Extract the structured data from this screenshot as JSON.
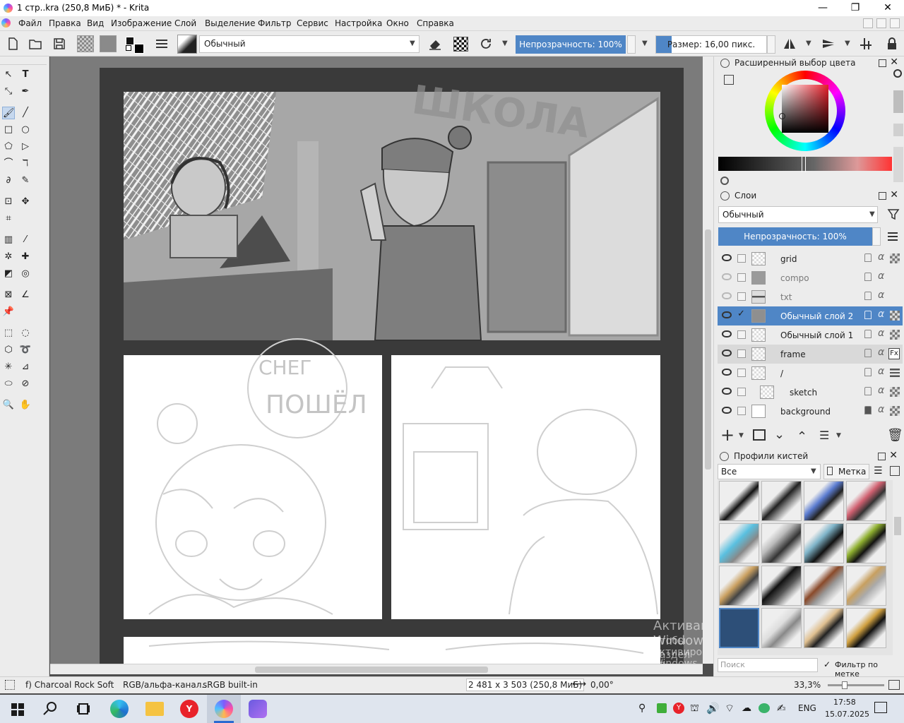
{
  "window": {
    "title": "1 стр..kra (250,8 МиБ) * - Krita",
    "minimize": "—",
    "maximize": "❐",
    "close": "✕"
  },
  "menu": {
    "items": [
      "Файл",
      "Правка",
      "Вид",
      "Изображение",
      "Слой",
      "Выделение",
      "Фильтр",
      "Сервис",
      "Настройка",
      "Окно",
      "Справка"
    ]
  },
  "toolbar": {
    "blend_mode": "Обычный",
    "opacity": "Непрозрачность: 100%",
    "size": "Размер: 16,00 пикс."
  },
  "advanced_color": {
    "title": "Расширенный выбор цвета",
    "hue_color": "#e8202a"
  },
  "layers": {
    "title": "Слои",
    "blend_mode": "Обычный",
    "opacity": "Непрозрачность:  100%",
    "rows": [
      {
        "name": "grid",
        "visible": true,
        "checked": false
      },
      {
        "name": "compo",
        "visible": false,
        "checked": false
      },
      {
        "name": "txt",
        "visible": false,
        "checked": false
      },
      {
        "name": "Обычный слой 2",
        "visible": true,
        "checked": true
      },
      {
        "name": "Обычный слой 1",
        "visible": true,
        "checked": false
      },
      {
        "name": "frame",
        "visible": true,
        "checked": false
      },
      {
        "name": "/",
        "visible": true,
        "checked": false
      },
      {
        "name": "sketch",
        "visible": true,
        "checked": false
      },
      {
        "name": "background",
        "visible": true,
        "checked": false
      }
    ],
    "alpha_glyph": "α",
    "fx_glyph": "Fx"
  },
  "brush_presets": {
    "title": "Профили кистей",
    "filter": "Все",
    "tag": "Метка",
    "search_placeholder": "Поиск",
    "filter_by_tag": "Фильтр по метке"
  },
  "canvas": {
    "panel_text_top": "ШКОЛА",
    "panel_text_bottom_left": "ПОШЁЛ",
    "panel_text_bottom_left_top": "СНЕГ"
  },
  "watermark": {
    "line1": "Активация Windows",
    "line2": "Чтобы активировать Windows, перейдите в",
    "line3": "раздел \"Параметры\"."
  },
  "status": {
    "brush": "f) Charcoal Rock Soft",
    "colorspace": "RGB/альфа-канал...",
    "profile": "sRGB built-in",
    "dimensions": "2 481 x 3 503 (250,8 МиБ)",
    "rotation": "0,00°",
    "zoom": "33,3%",
    "zoom_level": 0.333
  },
  "taskbar": {
    "lang": "ENG",
    "time": "17:58",
    "date": "15.07.2025"
  }
}
